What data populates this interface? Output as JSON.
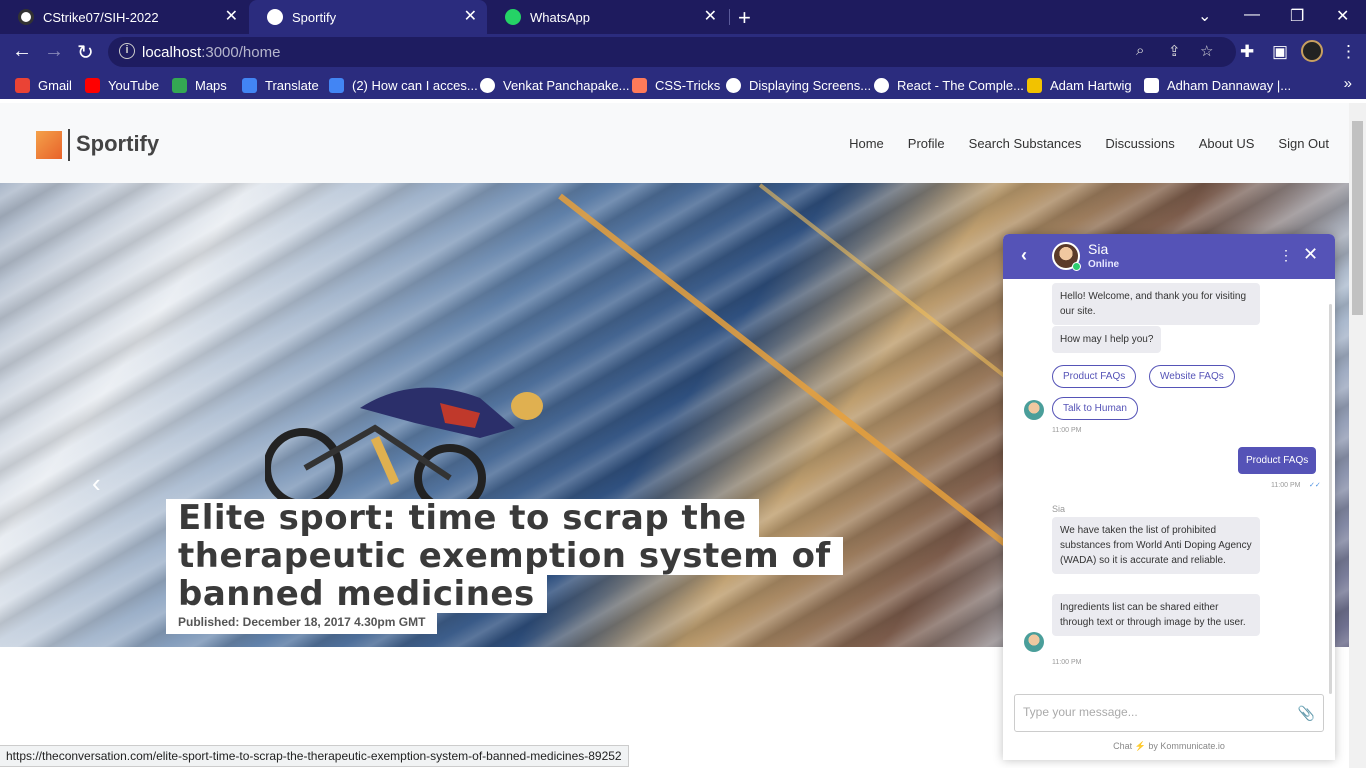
{
  "browser": {
    "tabs": [
      {
        "title": "CStrike07/SIH-2022",
        "active": false
      },
      {
        "title": "Sportify",
        "active": true
      },
      {
        "title": "WhatsApp",
        "active": false
      }
    ],
    "url_host": "localhost",
    "url_rest": ":3000/home",
    "bookmarks": [
      {
        "label": "Gmail",
        "color": "#ea4335"
      },
      {
        "label": "YouTube",
        "color": "#ff0000"
      },
      {
        "label": "Maps",
        "color": "#34a853"
      },
      {
        "label": "Translate",
        "color": "#4285f4"
      },
      {
        "label": "(2) How can I acces...",
        "color": "#4285f4"
      },
      {
        "label": "Venkat Panchapake...",
        "color": "#ffffff"
      },
      {
        "label": "CSS-Tricks",
        "color": "#ff7a59"
      },
      {
        "label": "Displaying Screens...",
        "color": "#ffffff"
      },
      {
        "label": "React - The Comple...",
        "color": "#ffffff"
      },
      {
        "label": "Adam Hartwig",
        "color": "#f2c200"
      },
      {
        "label": "Adham Dannaway |...",
        "color": "#ffffff"
      }
    ],
    "status_url": "https://theconversation.com/elite-sport-time-to-scrap-the-therapeutic-exemption-system-of-banned-medicines-89252"
  },
  "site": {
    "logo_text": "Sportify",
    "nav": [
      "Home",
      "Profile",
      "Search Substances",
      "Discussions",
      "About US",
      "Sign Out"
    ]
  },
  "hero": {
    "headline_lines": [
      "Elite sport: time to scrap the",
      "therapeutic exemption system of",
      "banned medicines"
    ],
    "published": "Published: December 18, 2017 4.30pm GMT"
  },
  "chat": {
    "bot_name": "Sia",
    "status": "Online",
    "messages": {
      "welcome": "Hello! Welcome, and thank you for visiting our site.",
      "help": "How may I help you?",
      "time1": "11:00 PM",
      "user_msg": "Product FAQs",
      "time2": "11:00 PM",
      "sender": "Sia",
      "answer1": "We have taken the list of prohibited substances from World Anti Doping Agency (WADA) so it is accurate and reliable.",
      "answer2": "Ingredients list can be shared either through text or through image by the user.",
      "time3": "11:00 PM"
    },
    "quick_replies": [
      "Product FAQs",
      "Website FAQs",
      "Talk to Human"
    ],
    "input_placeholder": "Type your message...",
    "powered_prefix": "Chat",
    "powered_suffix": "by Kommunicate.io"
  }
}
